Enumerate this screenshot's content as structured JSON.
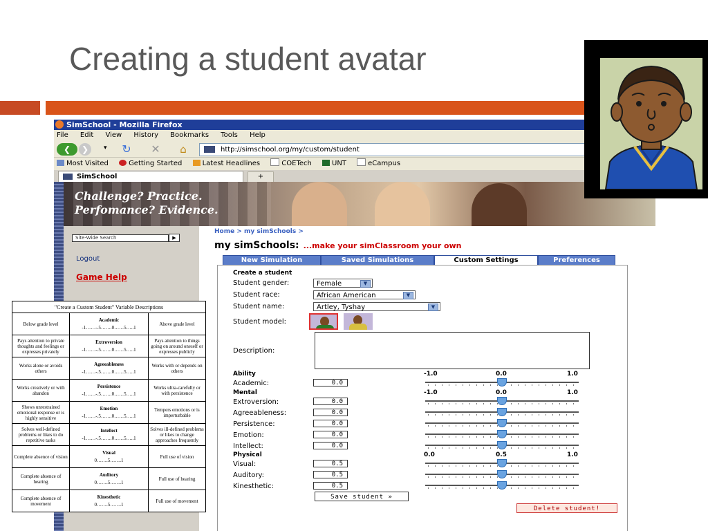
{
  "slide": {
    "title": "Creating a student avatar"
  },
  "browser": {
    "window_title": "SimSchool - Mozilla Firefox",
    "menu": [
      "File",
      "Edit",
      "View",
      "History",
      "Bookmarks",
      "Tools",
      "Help"
    ],
    "url": "http://simschool.org/my/custom/student",
    "bookmarks": [
      "Most Visited",
      "Getting Started",
      "Latest Headlines",
      "COETech",
      "UNT",
      "eCampus"
    ],
    "tab_title": "SimSchool",
    "newtab_label": "+"
  },
  "page": {
    "banner_line1": "Challenge? Practice.",
    "banner_line2": "Perfomance? Evidence.",
    "search_placeholder": "Site-Wide Search",
    "search_go": "▶",
    "logout": "Logout",
    "game_help": "Game Help",
    "breadcrumb": "Home > my simSchools >",
    "title": "my simSchools:",
    "subtitle": "...make your simClassroom your own",
    "tabs": [
      "New Simulation",
      "Saved Simulations",
      "Custom Settings",
      "Preferences"
    ],
    "active_tab": "Custom Settings"
  },
  "form": {
    "heading": "Create a student",
    "gender_label": "Student gender:",
    "gender_value": "Female",
    "race_label": "Student race:",
    "race_value": "African American",
    "name_label": "Student name:",
    "name_value": "Artley, Tyshay",
    "model_label": "Student model:",
    "description_label": "Description:",
    "sections": {
      "ability": "Ability",
      "mental": "Mental",
      "physical": "Physical"
    },
    "scale_labels": {
      "ability": [
        "-1.0",
        "0.0",
        "1.0"
      ],
      "mental": [
        "-1.0",
        "0.0",
        "1.0"
      ],
      "physical": [
        "0.0",
        "0.5",
        "1.0"
      ]
    },
    "fields": [
      {
        "label": "Academic:",
        "value": "0.0"
      },
      {
        "label": "Extroversion:",
        "value": "0.0"
      },
      {
        "label": "Agreeableness:",
        "value": "0.0"
      },
      {
        "label": "Persistence:",
        "value": "0.0"
      },
      {
        "label": "Emotion:",
        "value": "0.0"
      },
      {
        "label": "Intellect:",
        "value": "0.0"
      },
      {
        "label": "Visual:",
        "value": "0.5"
      },
      {
        "label": "Auditory:",
        "value": "0.5"
      },
      {
        "label": "Kinesthetic:",
        "value": "0.5"
      }
    ],
    "save_button": "Save student »",
    "delete_button": "Delete student!"
  },
  "variable_table": {
    "title": "\"Create a Custom Student\" Variable Descriptions",
    "rows": [
      {
        "left": "Below grade level",
        "name": "Academic",
        "scale": "-1……-.5…….0……5…..1",
        "right": "Above grade level"
      },
      {
        "left": "Pays attention to private thoughts and feelings or expresses privately",
        "name": "Extroversion",
        "scale": "-1……-.5…….0……5…..1",
        "right": "Pays attention to things going on around oneself or expresses publicly"
      },
      {
        "left": "Works alone or avoids others",
        "name": "Agreeableness",
        "scale": "-1……-.5…….0……5…..1",
        "right": "Works with or depends on others"
      },
      {
        "left": "Works creatively or with abandon",
        "name": "Persistence",
        "scale": "-1……-.5…….0……5…..1",
        "right": "Works ultra-carefully or with persistence"
      },
      {
        "left": "Shows unrestrained emotional response or is highly sensitive",
        "name": "Emotion",
        "scale": "-1……-.5…….0……5…..1",
        "right": "Tempers emotions or is imperturbable"
      },
      {
        "left": "Solves well-defined problems or likes to do repetitive tasks",
        "name": "Intellect",
        "scale": "-1……-.5…….0……5…..1",
        "right": "Solves ill-defined problems or likes to change approaches frequently"
      },
      {
        "left": "Complete absence of vision",
        "name": "Visual",
        "scale": "0…….5…….1",
        "right": "Full use of vision"
      },
      {
        "left": "Complete absence of hearing",
        "name": "Auditory",
        "scale": "0…….5…….1",
        "right": "Full use of hearing"
      },
      {
        "left": "Complete absence of movement",
        "name": "Kinesthetic",
        "scale": "0…….5…….1",
        "right": "Full use of movement"
      }
    ]
  }
}
